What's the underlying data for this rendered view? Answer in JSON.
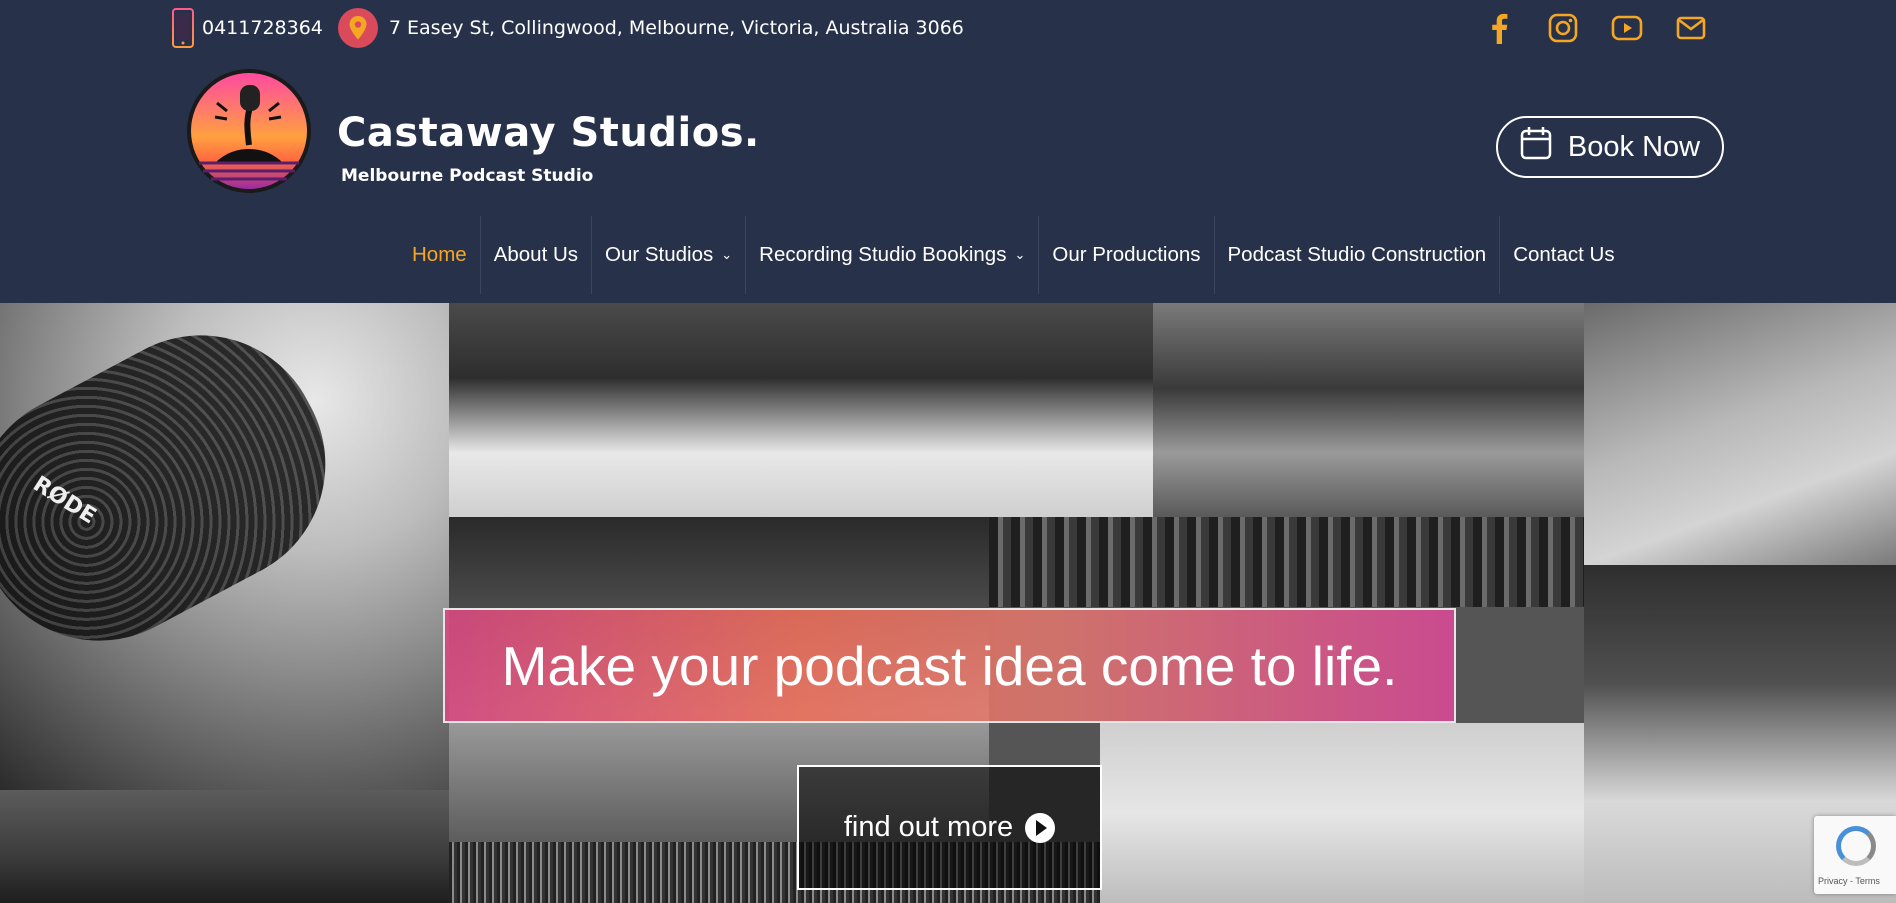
{
  "topbar": {
    "phone": "0411728364",
    "address": "7 Easey St, Collingwood, Melbourne, Victoria, Australia 3066",
    "icons": [
      "phone-icon",
      "location-pin-icon"
    ]
  },
  "socials": [
    {
      "name": "facebook-icon"
    },
    {
      "name": "instagram-icon"
    },
    {
      "name": "youtube-icon"
    },
    {
      "name": "email-icon"
    }
  ],
  "brand": {
    "title": "Castaway Studios.",
    "subtitle": "Melbourne Podcast Studio"
  },
  "book_button": {
    "label": "Book Now",
    "icon": "calendar-icon"
  },
  "nav": {
    "items": [
      {
        "label": "Home",
        "active": true
      },
      {
        "label": "About Us"
      },
      {
        "label": "Our Studios",
        "dropdown": true
      },
      {
        "label": "Recording Studio Bookings",
        "dropdown": true
      },
      {
        "label": "Our Productions"
      },
      {
        "label": "Podcast Studio Construction"
      },
      {
        "label": "Contact Us"
      }
    ]
  },
  "hero": {
    "rode_label": "RØDE",
    "headline": "Make your podcast idea come to life.",
    "cta": "find out more"
  },
  "recaptcha": {
    "text": "Privacy - Terms"
  },
  "colors": {
    "header_bg": "#27324a",
    "accent": "#f5a623",
    "headline_gradient": [
      "#d64880",
      "#ec6e5a",
      "#d64a96"
    ]
  }
}
